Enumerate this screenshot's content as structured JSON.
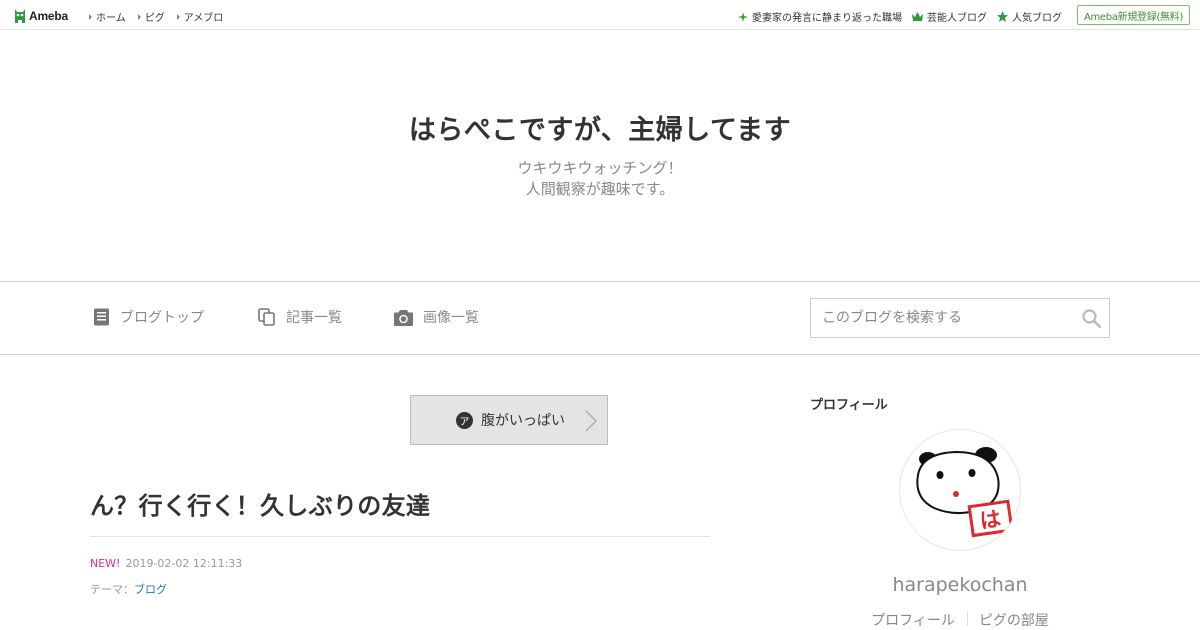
{
  "topbar": {
    "logo_text": "Ameba",
    "nav": [
      {
        "label": "ホーム"
      },
      {
        "label": "ピグ"
      },
      {
        "label": "アメブロ"
      }
    ],
    "links": [
      {
        "label": "愛妻家の発言に静まり返った職場",
        "icon": "sparkle-icon"
      },
      {
        "label": "芸能人ブログ",
        "icon": "crown-icon"
      },
      {
        "label": "人気ブログ",
        "icon": "star-icon"
      }
    ],
    "signup_label": "Ameba新規登録(無料)"
  },
  "header": {
    "title": "はらぺこですが、主婦してます",
    "description_line1": "ウキウキウォッチング！",
    "description_line2": "人間観察が趣味です。"
  },
  "blog_nav": {
    "items": [
      {
        "label": "ブログトップ",
        "icon": "document-icon"
      },
      {
        "label": "記事一覧",
        "icon": "copy-icon"
      },
      {
        "label": "画像一覧",
        "icon": "camera-icon"
      }
    ],
    "search_placeholder": "このブログを検索する"
  },
  "article": {
    "theme_badge": "ア",
    "theme_button_label": "腹がいっぱい",
    "title": "ん？行く行く！久しぶりの友達",
    "new_label": "NEW!",
    "date": "2019-02-02 12:11:33",
    "theme_prefix": "テーマ：",
    "theme_link": "ブログ"
  },
  "sidebar": {
    "heading": "プロフィール",
    "username": "harapekochan",
    "links": [
      {
        "label": "プロフィール"
      },
      {
        "label": "ピグの部屋"
      }
    ]
  },
  "colors": {
    "accent_green": "#3b8f2e",
    "new_pink": "#e0298c",
    "link_blue": "#2f6fb6"
  }
}
